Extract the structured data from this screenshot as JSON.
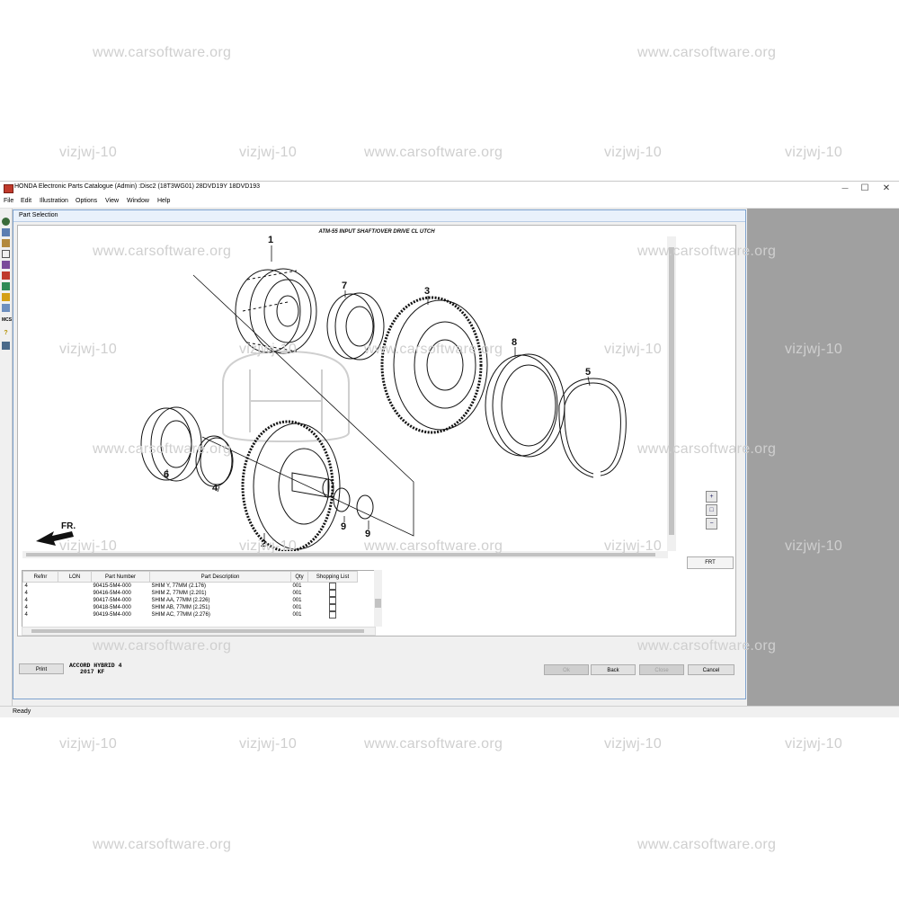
{
  "watermarks": {
    "site": "www.carsoftware.org",
    "code": "vizjwj-10"
  },
  "window": {
    "title": "HONDA Electronic Parts Catalogue  (Admin)  :Disc2  (18T3WG01)  28DVD19Y  18DVD193",
    "minimize_glyph": "—",
    "maximize_glyph": "☐",
    "close_glyph": "✕"
  },
  "menu": [
    "File",
    "Edit",
    "Illustration",
    "Options",
    "View",
    "Window",
    "Help"
  ],
  "toolstrip_icons": [
    "catalog-icon",
    "vehicle-icon",
    "parts-icon",
    "search-icon",
    "list-icon",
    "order-icon",
    "print-icon",
    "edit-icon",
    "notes-icon",
    "mcs-icon",
    "help-icon",
    "tool-icon"
  ],
  "mcs_label": "MCS",
  "part_selection": {
    "title": "Part Selection",
    "illustration_title": "ATM-55 INPUT SHAFT/OVER DRIVE CL UTCH",
    "callouts": [
      "1",
      "7",
      "3",
      "8",
      "5",
      "6",
      "4",
      "2",
      "9",
      "9"
    ],
    "fr_label": "FR.",
    "frt_button": "FRT",
    "zoom_buttons": [
      "zoom-in",
      "zoom-fit",
      "zoom-out"
    ],
    "zoom_glyphs": [
      "+",
      "□",
      "−"
    ],
    "columns": [
      "Refnr",
      "LON",
      "Part Number",
      "Part Description",
      "Qty",
      "Shopping List"
    ],
    "rows": [
      {
        "ref": "4",
        "lon": "",
        "part_number": "90415-5M4-000",
        "description": "SHIM Y, 77MM (2.176)",
        "qty": "001"
      },
      {
        "ref": "4",
        "lon": "",
        "part_number": "90416-5M4-000",
        "description": "SHIM Z, 77MM (2.201)",
        "qty": "001"
      },
      {
        "ref": "4",
        "lon": "",
        "part_number": "90417-5M4-000",
        "description": "SHIM AA, 77MM (2.226)",
        "qty": "001"
      },
      {
        "ref": "4",
        "lon": "",
        "part_number": "90418-5M4-000",
        "description": "SHIM AB, 77MM (2.251)",
        "qty": "001"
      },
      {
        "ref": "4",
        "lon": "",
        "part_number": "90419-5M4-000",
        "description": "SHIM AC, 77MM (2.276)",
        "qty": "001"
      }
    ],
    "model_line1": "ACCORD HYBRID 4",
    "model_line2": "2017 KF",
    "buttons": {
      "print": "Print",
      "ok": "Ok",
      "back": "Back",
      "close": "Close",
      "cancel": "Cancel"
    }
  },
  "status": "Ready"
}
